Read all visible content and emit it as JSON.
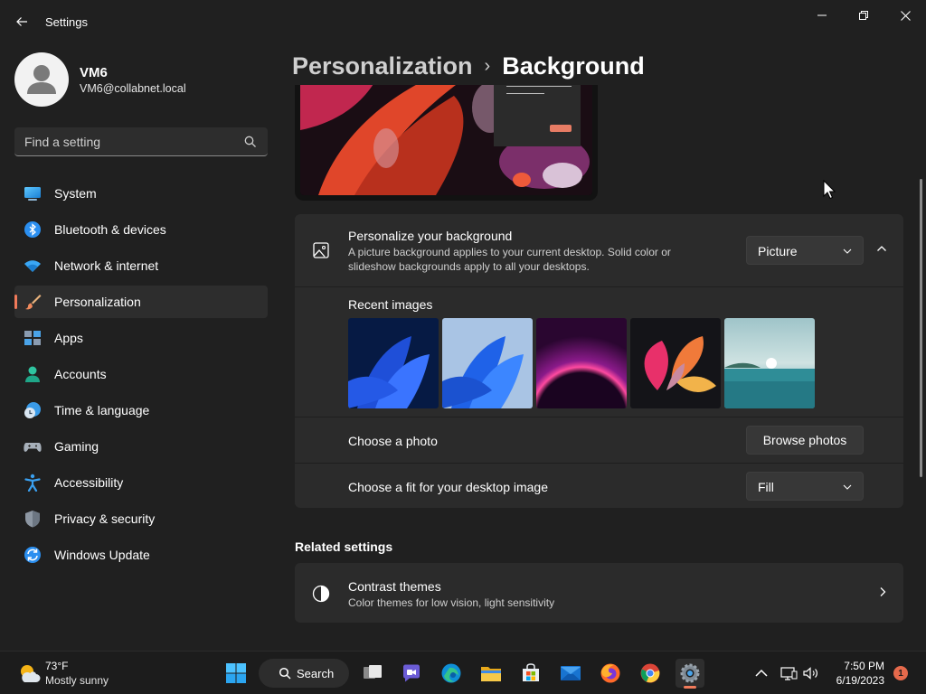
{
  "window": {
    "title": "Settings",
    "back_icon": "arrow-left-icon",
    "controls": [
      "minimize-icon",
      "restore-icon",
      "close-icon"
    ]
  },
  "user": {
    "name": "VM6",
    "email": "VM6@collabnet.local"
  },
  "search": {
    "placeholder": "Find a setting"
  },
  "sidebar": {
    "items": [
      {
        "label": "System",
        "icon": "monitor-icon",
        "active": false
      },
      {
        "label": "Bluetooth & devices",
        "icon": "bluetooth-icon",
        "active": false
      },
      {
        "label": "Network & internet",
        "icon": "wifi-icon",
        "active": false
      },
      {
        "label": "Personalization",
        "icon": "brush-icon",
        "active": true
      },
      {
        "label": "Apps",
        "icon": "apps-icon",
        "active": false
      },
      {
        "label": "Accounts",
        "icon": "person-icon",
        "active": false
      },
      {
        "label": "Time & language",
        "icon": "clock-globe-icon",
        "active": false
      },
      {
        "label": "Gaming",
        "icon": "gamepad-icon",
        "active": false
      },
      {
        "label": "Accessibility",
        "icon": "accessibility-icon",
        "active": false
      },
      {
        "label": "Privacy & security",
        "icon": "shield-icon",
        "active": false
      },
      {
        "label": "Windows Update",
        "icon": "update-icon",
        "active": false
      }
    ]
  },
  "breadcrumb": {
    "parent": "Personalization",
    "separator": "›",
    "current": "Background"
  },
  "background_card": {
    "personalize": {
      "title": "Personalize your background",
      "description": "A picture background applies to your current desktop. Solid color or slideshow backgrounds apply to all your desktops.",
      "selected": "Picture"
    },
    "recent_images": {
      "title": "Recent images",
      "thumbnails": [
        "bloom-blue-dark",
        "bloom-blue-light",
        "glow-purple",
        "flower-abstract",
        "sea-landscape"
      ]
    },
    "choose_photo": {
      "title": "Choose a photo",
      "button": "Browse photos"
    },
    "fit": {
      "title": "Choose a fit for your desktop image",
      "selected": "Fill"
    }
  },
  "related": {
    "title": "Related settings",
    "contrast": {
      "title": "Contrast themes",
      "description": "Color themes for low vision, light sensitivity"
    }
  },
  "taskbar": {
    "weather": {
      "temp": "73°F",
      "desc": "Mostly sunny"
    },
    "search_label": "Search",
    "apps": [
      "start-icon",
      "task-view-icon",
      "chat-icon",
      "edge-icon",
      "file-explorer-icon",
      "store-icon",
      "mail-icon",
      "firefox-icon",
      "chrome-icon",
      "settings-icon"
    ],
    "clock": {
      "time": "7:50 PM",
      "date": "6/19/2023"
    },
    "notifications": "1"
  },
  "colors": {
    "accent": "#f07a5a",
    "background": "#202020",
    "card": "#2b2b2b"
  }
}
